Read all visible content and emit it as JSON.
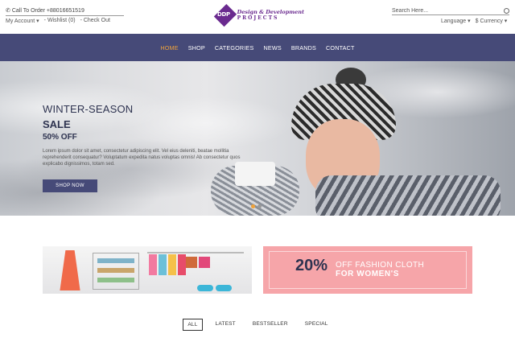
{
  "header": {
    "phone_label": "Call To Order +88016651519",
    "account_links": [
      "My Account",
      "Wishlist (0)",
      "Check Out"
    ],
    "logo_initials": "DDP",
    "logo_line1": "Design & Development",
    "logo_line2": "PROJECTS",
    "search_placeholder": "Search Here...",
    "language_label": "Language",
    "currency_label": "$ Currency"
  },
  "nav": {
    "items": [
      "HOME",
      "SHOP",
      "CATEGORIES",
      "NEWS",
      "BRANDS",
      "CONTACT"
    ],
    "active": "HOME"
  },
  "hero": {
    "title": "WINTER-SEASON",
    "subtitle": "SALE",
    "discount": "50% OFF",
    "body": "Lorem ipsum dolor sit amet, consectetur adipiscing elit. Vel eius deleniti, beatae mollitia reprehenderit consequatur? Voluptatum expedita natus voluptas omnis! Ab consectetur quos explicabo dignissimos, totam sed.",
    "button_label": "SHOP NOW"
  },
  "promo": {
    "percent": "20%",
    "line1": "OFF FASHION CLOTH",
    "line2": "FOR WOMEN'S"
  },
  "product_tabs": {
    "items": [
      "ALL",
      "LATEST",
      "BESTSELLER",
      "SPECIAL"
    ],
    "active": "ALL"
  },
  "colors": {
    "nav_bg": "#464a78",
    "accent": "#f0a33a",
    "promo_bg": "#f6a5a9",
    "brand_purple": "#6a2a8f"
  }
}
